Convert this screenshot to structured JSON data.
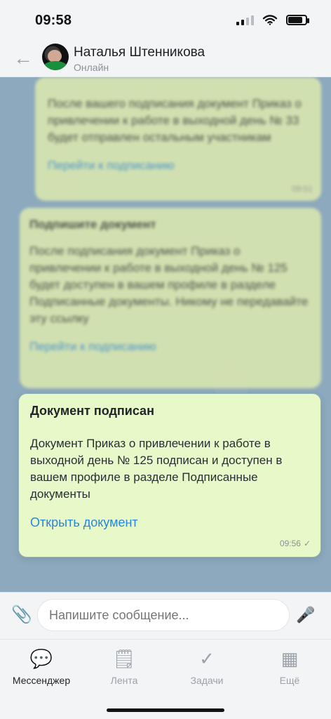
{
  "status_bar": {
    "time": "09:58",
    "icons": [
      "signal-icon",
      "wifi-icon",
      "battery-icon"
    ]
  },
  "header": {
    "back_icon": "back-arrow-icon",
    "contact_name": "Наталья Штенникова",
    "contact_status": "Онлайн"
  },
  "messages": {
    "blurred": [
      {
        "title": "",
        "text": "После вашего подписания документ Приказ о привлечении к работе в выходной день № 33 будет отправлен остальным участникам",
        "link": "Перейти к подписанию",
        "time": "09:51"
      },
      {
        "title": "Подпишите документ",
        "text": "После подписания документ Приказ о привлечении к работе в выходной день № 125 будет доступен в вашем профиле в разделе Подписанные документы. Никому не передавайте эту ссылку",
        "link": "Перейти к подписанию",
        "time": ""
      }
    ],
    "focused": {
      "title": "Документ подписан",
      "text": "Документ Приказ о привлечении к работе в выходной день № 125 подписан и доступен в вашем профиле в разделе Подписанные документы",
      "link": "Открыть документ",
      "time": "09:56"
    }
  },
  "composer": {
    "attach_icon": "paperclip-icon",
    "placeholder": "Напишите сообщение...",
    "mic_icon": "microphone-icon"
  },
  "bottom_nav": {
    "items": [
      {
        "label": "Мессенджер",
        "icon": "messenger-icon",
        "active": true
      },
      {
        "label": "Лента",
        "icon": "feed-icon",
        "active": false
      },
      {
        "label": "Задачи",
        "icon": "tasks-icon",
        "active": false
      },
      {
        "label": "Ещё",
        "icon": "more-icon",
        "active": false
      }
    ]
  }
}
